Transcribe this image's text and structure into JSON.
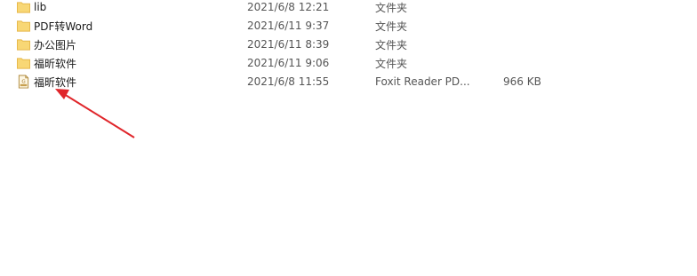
{
  "files": [
    {
      "name": "lib",
      "date": "2021/6/8 12:21",
      "type": "文件夹",
      "size": "",
      "icon": "folder-icon"
    },
    {
      "name": "PDF转Word",
      "date": "2021/6/11 9:37",
      "type": "文件夹",
      "size": "",
      "icon": "folder-icon"
    },
    {
      "name": "办公图片",
      "date": "2021/6/11 8:39",
      "type": "文件夹",
      "size": "",
      "icon": "folder-icon"
    },
    {
      "name": "福昕软件",
      "date": "2021/6/11 9:06",
      "type": "文件夹",
      "size": "",
      "icon": "folder-icon"
    },
    {
      "name": "福昕软件",
      "date": "2021/6/8 11:55",
      "type": "Foxit Reader PD...",
      "size": "966 KB",
      "icon": "foxit-shortcut-icon"
    }
  ],
  "colors": {
    "folder": "#f8d775",
    "folder_dark": "#e6b84a",
    "annotation_arrow": "#e0262b"
  }
}
